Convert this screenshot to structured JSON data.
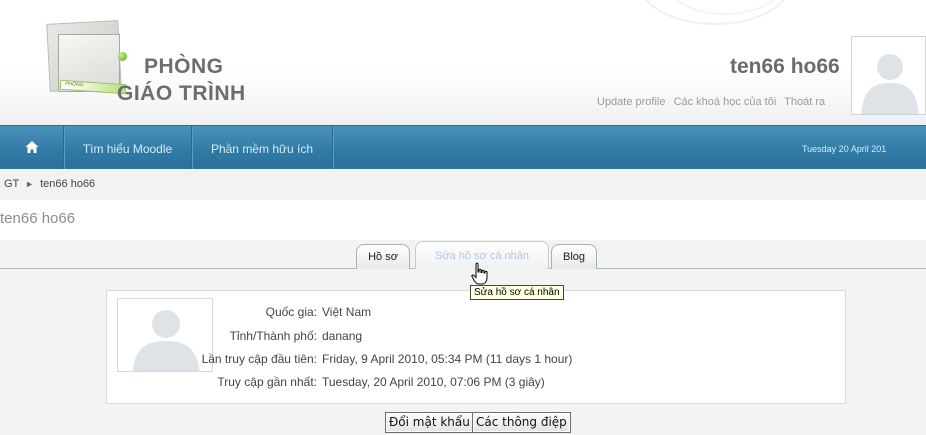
{
  "header": {
    "site_title_line1": "PHÒNG",
    "site_title_line2": "GIÁO TRÌNH",
    "logo_strip_text": "PHÒNG",
    "user_name": "ten66 ho66",
    "links": [
      "Update profile",
      "Các khoá học của tôi",
      "Thoát ra"
    ]
  },
  "nav": {
    "home_icon": "home-icon",
    "items": [
      "Tìm hiểu Moodle",
      "Phần mềm hữu ích"
    ],
    "date": "Tuesday 20 April 201"
  },
  "breadcrumb": {
    "root": "GT",
    "separator": "►",
    "current": "ten66 ho66"
  },
  "page": {
    "heading": "ten66 ho66"
  },
  "tabs": [
    {
      "label": "Hồ sơ"
    },
    {
      "label": "Sửa hồ sơ cá nhân"
    },
    {
      "label": "Blog"
    }
  ],
  "tooltip": "Sửa hồ sơ cá nhân",
  "profile": {
    "fields": [
      {
        "label": "Quốc gia:",
        "value": "Việt Nam"
      },
      {
        "label": "Tỉnh/Thành phố:",
        "value": "danang"
      },
      {
        "label": "Lần truy cập đầu tiên:",
        "value": "Friday, 9 April 2010, 05:34 PM  (11 days 1 hour)"
      },
      {
        "label": "Truy cập gần nhất:",
        "value": "Tuesday, 20 April 2010, 07:06 PM  (3 giây)"
      }
    ]
  },
  "buttons": {
    "change_password": "Đổi mật khẩu",
    "messages": "Các thông điệp"
  },
  "colors": {
    "navbar": "#2f7aa6",
    "tab_edit_text": "#aec6e3",
    "tooltip_bg": "#ffffe1"
  }
}
